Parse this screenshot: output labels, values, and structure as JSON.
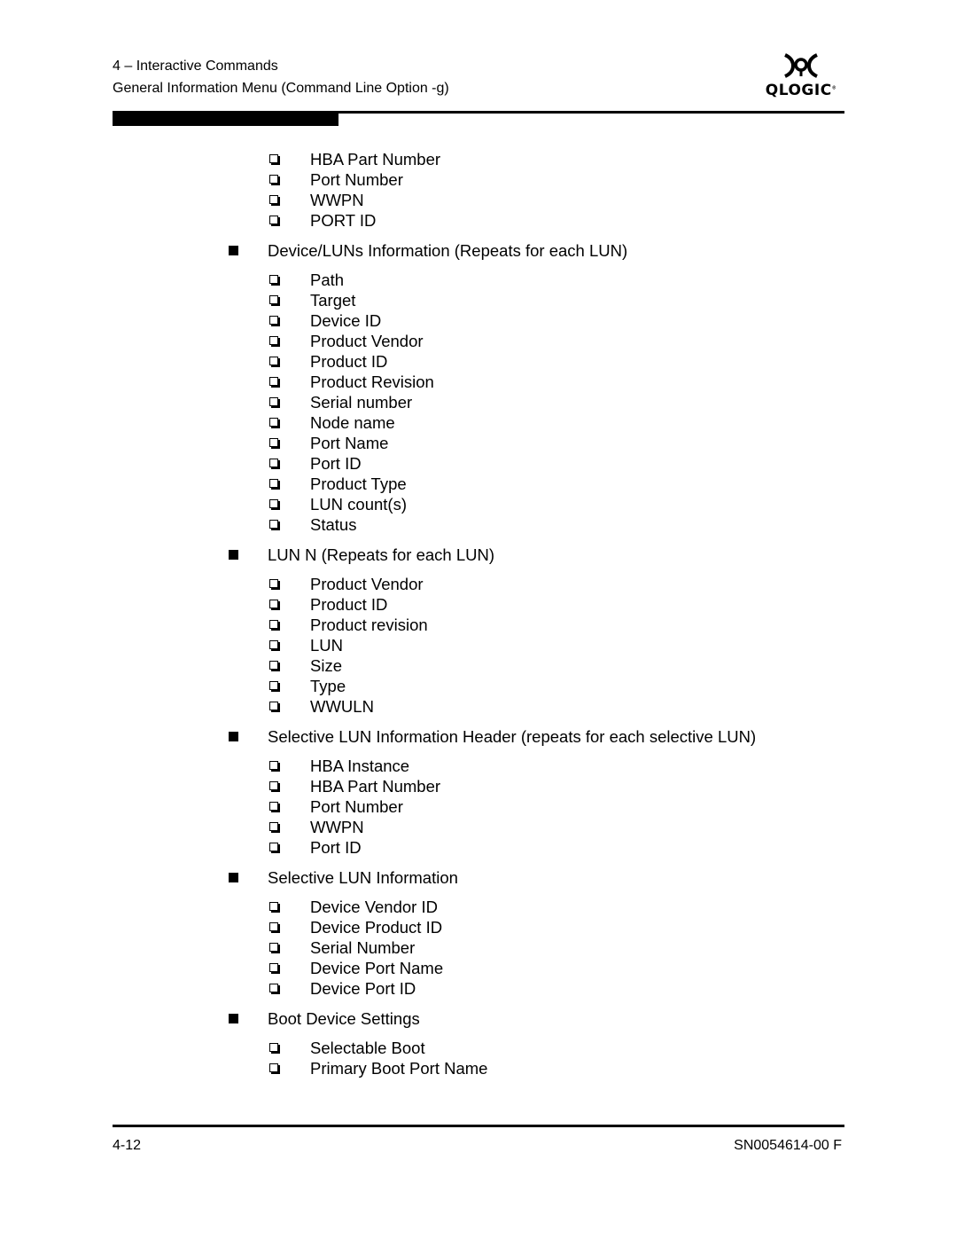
{
  "header": {
    "chapter": "4 – Interactive Commands",
    "section": "General Information Menu (Command Line Option -g)",
    "logo_text": "QLOGIC",
    "logo_icon": "qlogic-logo-icon"
  },
  "content": {
    "lead_items": [
      "HBA Part Number",
      "Port Number",
      "WWPN",
      "PORT ID"
    ],
    "sections": [
      {
        "title": "Device/LUNs Information (Repeats for each LUN)",
        "items": [
          "Path",
          "Target",
          "Device ID",
          "Product Vendor",
          "Product ID",
          "Product Revision",
          "Serial number",
          "Node name",
          "Port Name",
          "Port ID",
          "Product Type",
          "LUN count(s)",
          "Status"
        ]
      },
      {
        "title": "LUN N (Repeats for each LUN)",
        "items": [
          "Product Vendor",
          "Product ID",
          "Product revision",
          "LUN",
          "Size",
          "Type",
          "WWULN"
        ]
      },
      {
        "title": "Selective LUN Information Header (repeats for each selective LUN)",
        "items": [
          "HBA Instance",
          "HBA Part Number",
          "Port Number",
          "WWPN",
          "Port ID"
        ]
      },
      {
        "title": "Selective LUN Information",
        "items": [
          "Device Vendor ID",
          "Device Product ID",
          "Serial Number",
          "Device Port Name",
          "Device Port ID"
        ]
      },
      {
        "title": "Boot Device Settings",
        "items": [
          "Selectable Boot",
          "Primary Boot Port Name"
        ]
      }
    ]
  },
  "footer": {
    "page_number": "4-12",
    "document_number": "SN0054614-00  F"
  }
}
